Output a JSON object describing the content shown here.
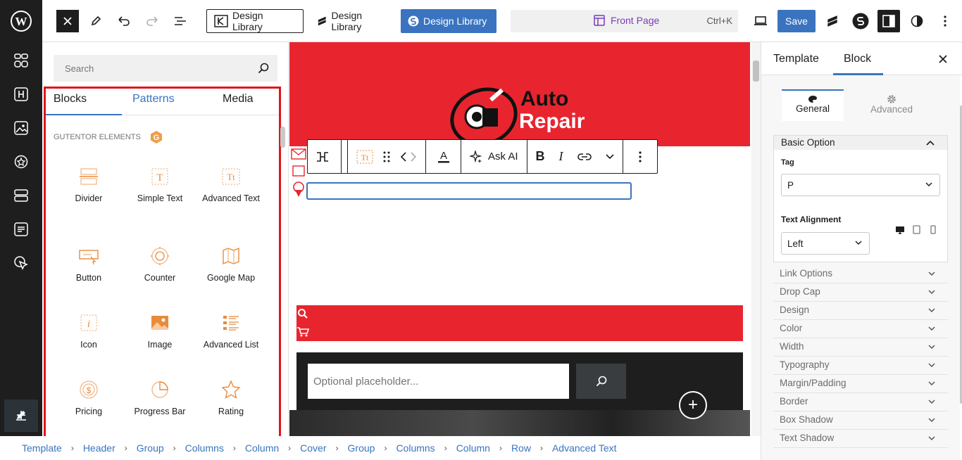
{
  "topbar": {
    "design_library_1": "Design Library",
    "design_library_2": "Design Library",
    "design_library_3": "Design Library",
    "doc_title": "Front Page",
    "doc_shortcut": "Ctrl+K",
    "save_label": "Save"
  },
  "inserter": {
    "search_placeholder": "Search",
    "tabs": [
      "Blocks",
      "Patterns",
      "Media"
    ],
    "category_title": "GUTENTOR ELEMENTS",
    "blocks": [
      {
        "label": "Divider",
        "icon": "divider-icon"
      },
      {
        "label": "Simple Text",
        "icon": "simple-text-icon"
      },
      {
        "label": "Advanced Text",
        "icon": "advanced-text-icon"
      },
      {
        "label": "Button",
        "icon": "button-icon"
      },
      {
        "label": "Counter",
        "icon": "counter-icon"
      },
      {
        "label": "Google Map",
        "icon": "map-icon"
      },
      {
        "label": "Icon",
        "icon": "icon-icon"
      },
      {
        "label": "Image",
        "icon": "image-icon"
      },
      {
        "label": "Advanced List",
        "icon": "list-icon"
      },
      {
        "label": "Pricing",
        "icon": "pricing-icon"
      },
      {
        "label": "Progress Bar",
        "icon": "progress-bar-icon"
      },
      {
        "label": "Rating",
        "icon": "star-icon"
      }
    ]
  },
  "canvas": {
    "logo_line1": "Auto",
    "logo_line2": "Repair",
    "toolbar_ask_ai": "Ask AI",
    "search_placeholder": "Optional placeholder..."
  },
  "settings": {
    "tab_template": "Template",
    "tab_block": "Block",
    "tab_general": "General",
    "tab_advanced": "Advanced",
    "basic_option": "Basic Option",
    "tag_label": "Tag",
    "tag_value": "P",
    "align_label": "Text Alignment",
    "align_value": "Left",
    "sections": [
      "Link Options",
      "Drop Cap",
      "Design",
      "Color",
      "Width",
      "Typography",
      "Margin/Padding",
      "Border",
      "Box Shadow",
      "Text Shadow"
    ]
  },
  "breadcrumb": [
    "Template",
    "Header",
    "Group",
    "Columns",
    "Column",
    "Cover",
    "Group",
    "Columns",
    "Column",
    "Row",
    "Advanced Text"
  ],
  "colors": {
    "accent": "#3a74c0",
    "hero_red": "#e8252f",
    "highlight_frame": "#e3141a",
    "block_icon_orange": "#e88b3a"
  }
}
